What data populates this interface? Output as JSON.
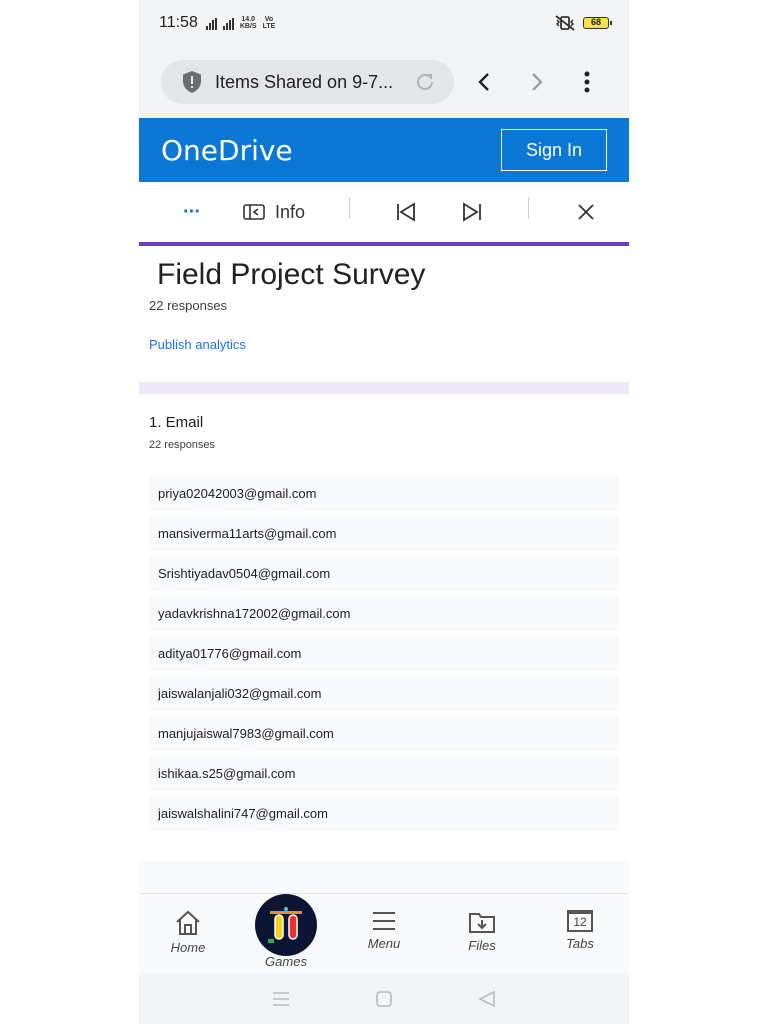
{
  "status_bar": {
    "time": "11:58",
    "network_small": "⁴⁶",
    "speed_value": "14.0",
    "speed_unit": "KB/S",
    "volte_top": "Vo",
    "volte_bottom": "LTE",
    "battery": "68"
  },
  "browser": {
    "url_title": "Items Shared on 9-7...",
    "icons": [
      "shield-icon",
      "reload-icon",
      "back-icon",
      "forward-icon",
      "more-vert-icon"
    ]
  },
  "onedrive": {
    "brand": "OneDrive",
    "sign_in": "Sign In",
    "accent": "#0a78d4"
  },
  "toolbar": {
    "more_label": "···",
    "info_label": "Info",
    "icons": [
      "info-panel-icon",
      "previous-icon",
      "next-icon",
      "close-icon"
    ]
  },
  "form": {
    "title": "Field Project Survey",
    "responses": "22 responses",
    "publish": "Publish analytics"
  },
  "question": {
    "title": "1. Email",
    "responses": "22 responses",
    "answers": [
      "priya02042003@gmail.com",
      "mansiverma11arts@gmail.com",
      "Srishtiyadav0504@gmail.com",
      "yadavkrishna172002@gmail.com",
      "aditya01776@gmail.com",
      "jaiswalanjali032@gmail.com",
      "manjujaiswal7983@gmail.com",
      "ishikaa.s25@gmail.com",
      "jaiswalshalini747@gmail.com"
    ]
  },
  "bottom_nav": {
    "home": "Home",
    "games": "Games",
    "menu": "Menu",
    "files": "Files",
    "tabs": "Tabs",
    "tabs_count": "12"
  }
}
